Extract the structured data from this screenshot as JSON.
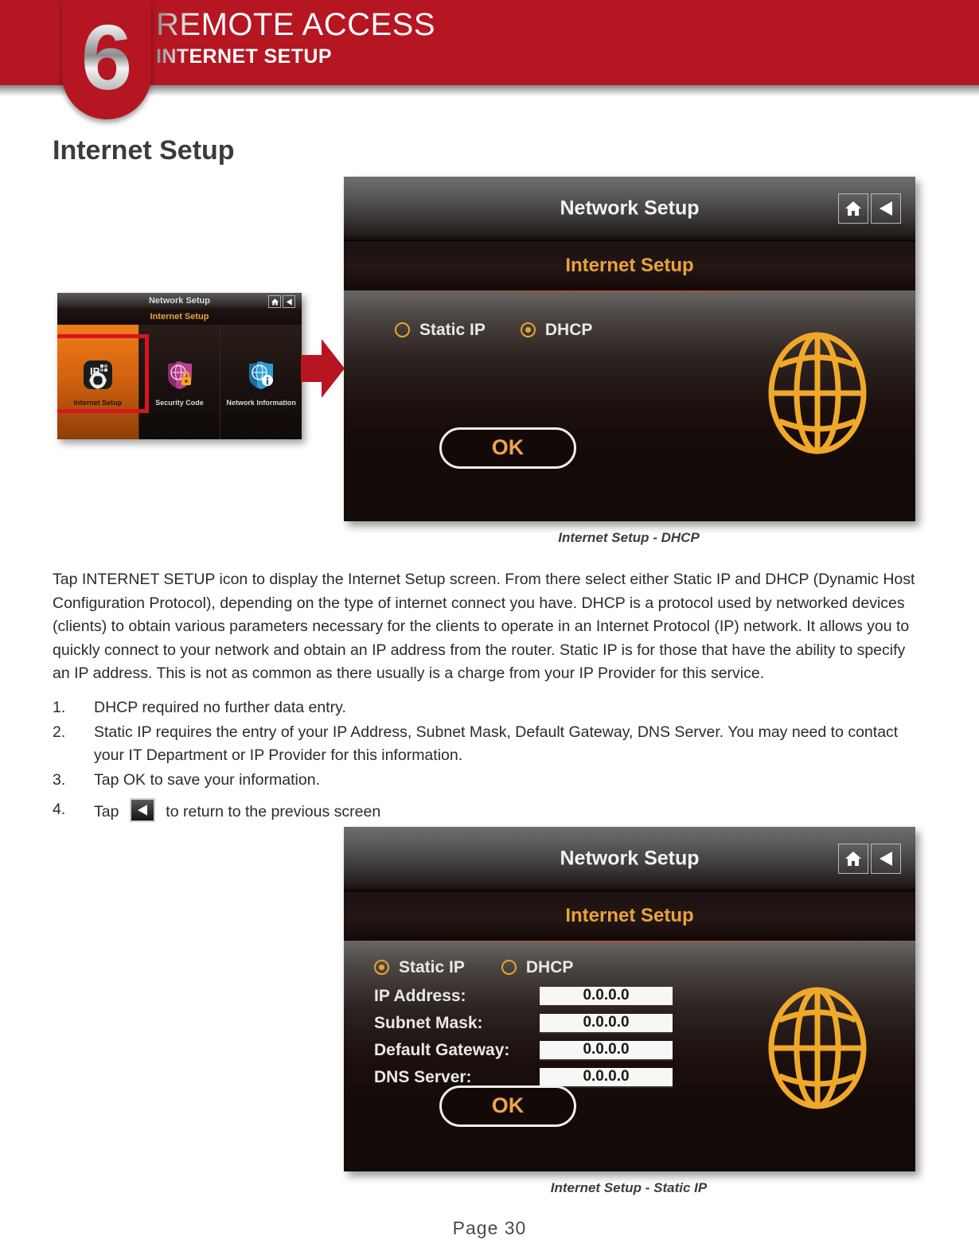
{
  "header": {
    "chapter_number": "6",
    "title": "REMOTE ACCESS",
    "subtitle": "INTERNET SETUP",
    "accent_color": "#b51622"
  },
  "section": {
    "heading": "Internet Setup"
  },
  "thumbnail": {
    "topbar_title": "Network Setup",
    "subbar_title": "Internet Setup",
    "home_icon": "home-icon",
    "back_icon": "back-chevron-icon",
    "tiles": [
      {
        "label": "Internet Setup",
        "icon": "ip-gear-icon",
        "selected": true
      },
      {
        "label": "Security Code",
        "icon": "shield-lock-icon",
        "selected": false
      },
      {
        "label": "Network Information",
        "icon": "shield-globe-info-icon",
        "selected": false
      }
    ],
    "highlight_color": "#d8151f",
    "arrow_icon": "right-arrow-icon",
    "arrow_color": "#b51622"
  },
  "screen_dhcp": {
    "topbar_title": "Network Setup",
    "subbar_title": "Internet Setup",
    "home_icon": "home-icon",
    "back_icon": "back-chevron-icon",
    "globe_icon": "globe-icon",
    "accent_color": "#e7a531",
    "options": [
      {
        "label": "Static IP",
        "selected": false
      },
      {
        "label": "DHCP",
        "selected": true
      }
    ],
    "ok_label": "OK",
    "caption": "Internet Setup - DHCP"
  },
  "screen_static": {
    "topbar_title": "Network Setup",
    "subbar_title": "Internet Setup",
    "home_icon": "home-icon",
    "back_icon": "back-chevron-icon",
    "globe_icon": "globe-icon",
    "accent_color": "#e7a531",
    "options": [
      {
        "label": "Static IP",
        "selected": true
      },
      {
        "label": "DHCP",
        "selected": false
      }
    ],
    "fields": [
      {
        "label": "IP Address:",
        "value": "0.0.0.0"
      },
      {
        "label": "Subnet Mask:",
        "value": "0.0.0.0"
      },
      {
        "label": "Default Gateway:",
        "value": "0.0.0.0"
      },
      {
        "label": "DNS Server:",
        "value": "0.0.0.0"
      }
    ],
    "ok_label": "OK",
    "caption": "Internet Setup - Static IP"
  },
  "body": {
    "paragraph": "Tap INTERNET SETUP icon to display the Internet Setup screen. From there select either Static IP and DHCP (Dynamic Host Configuration Protocol), depending on the type of internet connect you have. DHCP is a protocol used by networked devices (clients) to obtain various parameters necessary for the clients to operate in an Internet Protocol (IP) network. It allows you to quickly connect to your network and obtain an IP address from the router. Static IP is for those that have the ability to specify an IP address. This is not as common as there usually is a charge from your IP Provider for this service.",
    "list": [
      {
        "num": "1.",
        "text": "DHCP required no further data entry."
      },
      {
        "num": "2.",
        "text": "Static IP requires the entry of your IP Address, Subnet Mask, Default Gateway, DNS Server. You may need to contact your IT Department or IP Provider for this information."
      },
      {
        "num": "3.",
        "text": "Tap OK to save your information."
      },
      {
        "num": "4.",
        "text_before": "Tap",
        "icon": "back-chevron-icon",
        "text_after": "to return to the previous screen"
      }
    ]
  },
  "footer": {
    "page_number": "Page  30"
  }
}
